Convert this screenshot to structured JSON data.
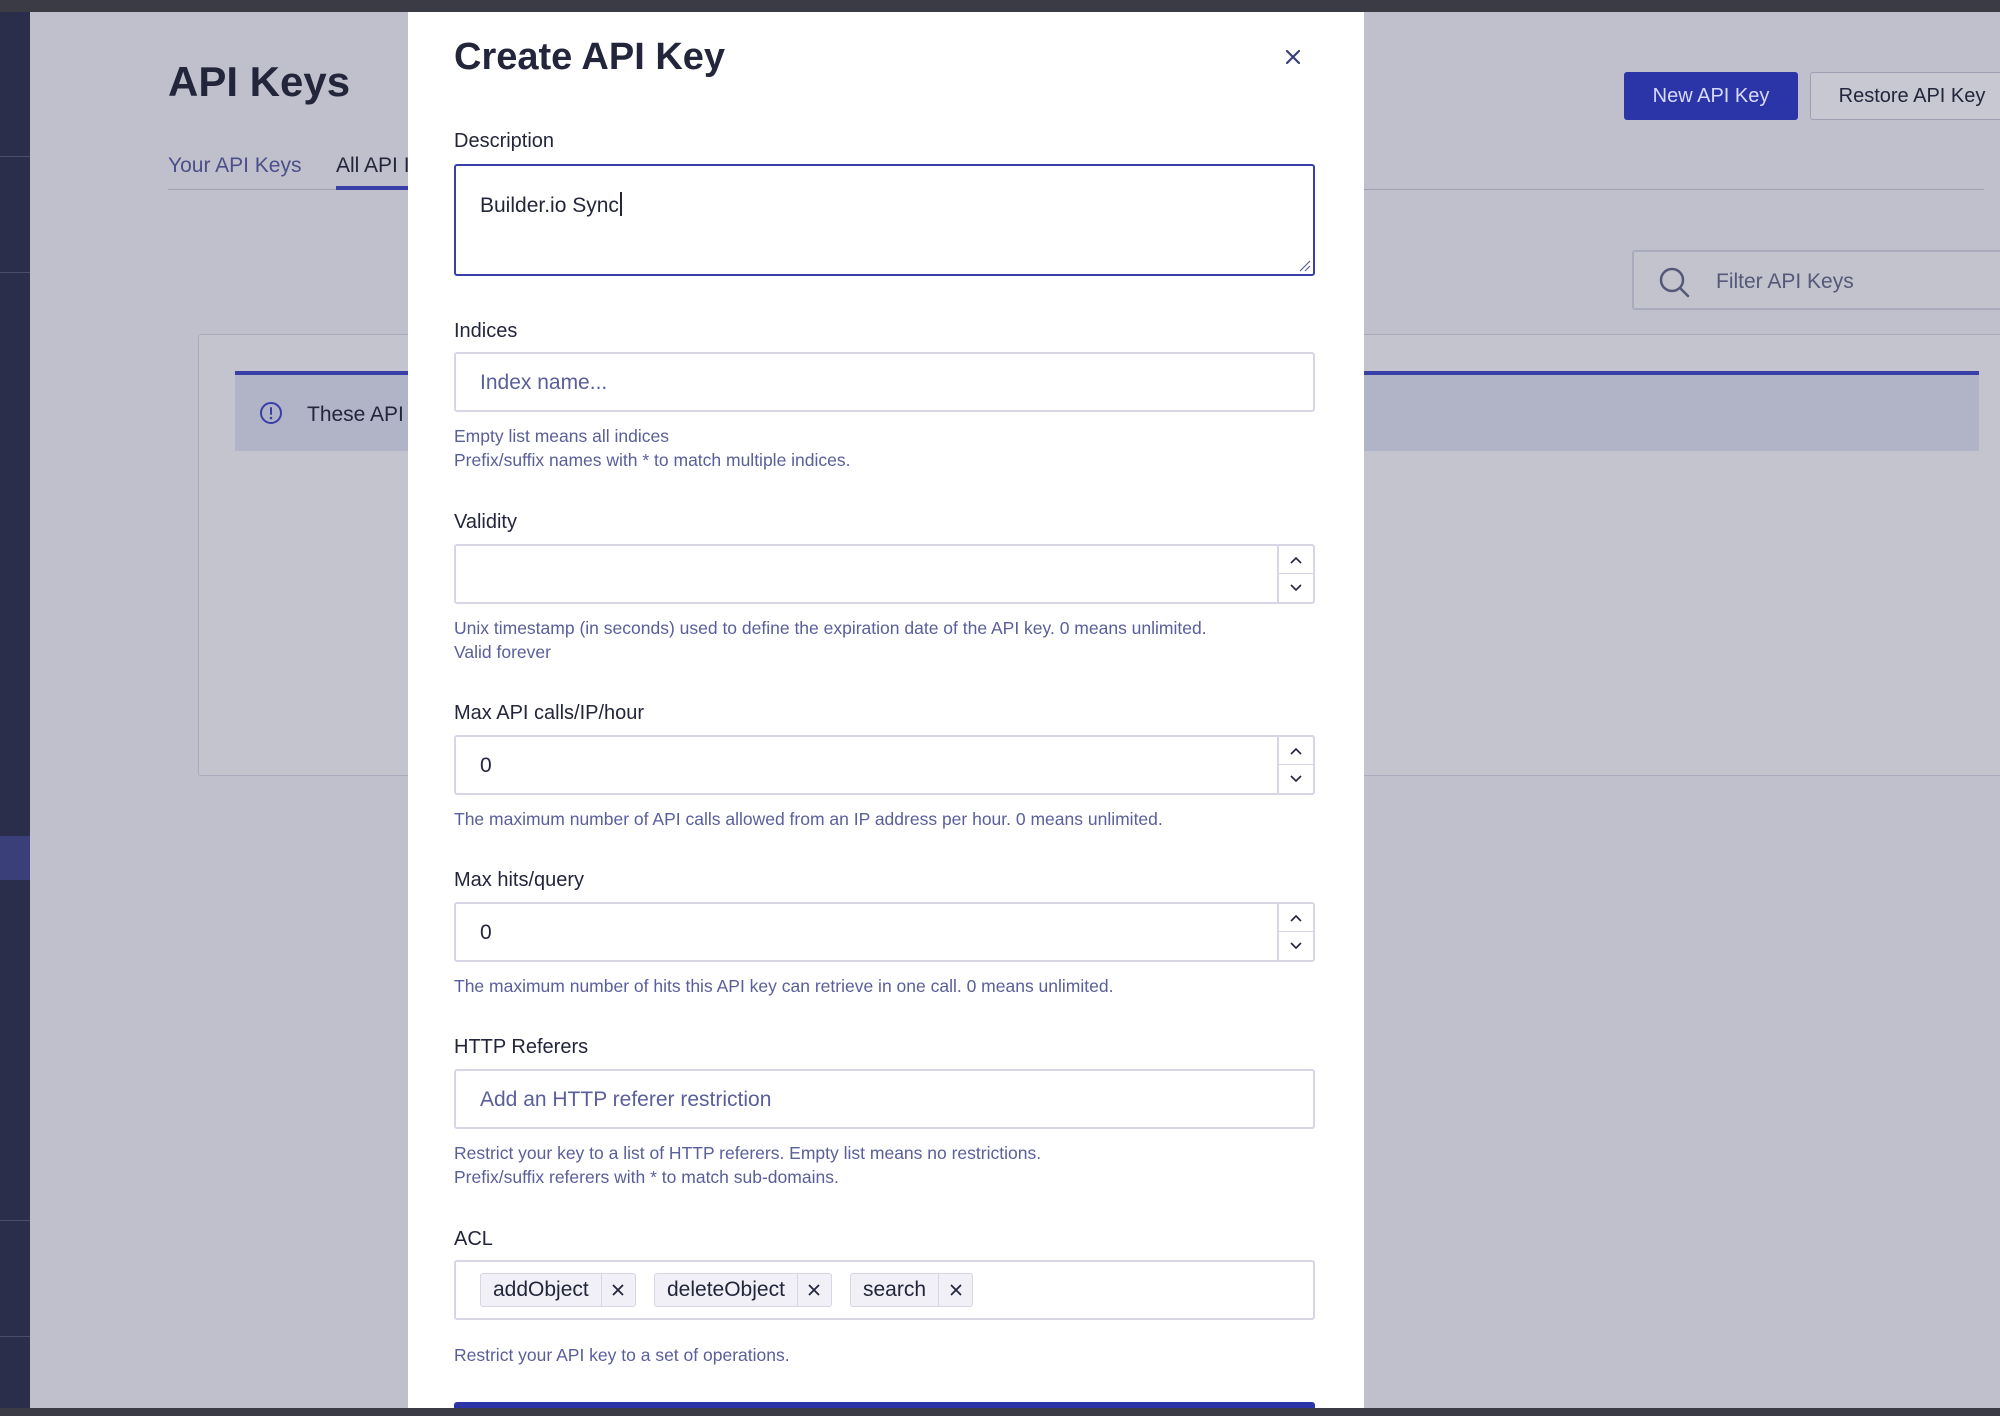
{
  "background": {
    "page_title": "API Keys",
    "tabs": [
      {
        "label": "Your API Keys"
      },
      {
        "label": "All API I"
      }
    ],
    "new_button": "New API Key",
    "restore_button": "Restore API Key",
    "filter_placeholder": "Filter API Keys",
    "banner_text": "These API Key"
  },
  "modal": {
    "title": "Create API Key",
    "description": {
      "label": "Description",
      "value": "Builder.io Sync"
    },
    "indices": {
      "label": "Indices",
      "placeholder": "Index name...",
      "help_1": "Empty list means all indices",
      "help_2": "Prefix/suffix names with * to match multiple indices."
    },
    "validity": {
      "label": "Validity",
      "value": "",
      "help_1": "Unix timestamp (in seconds) used to define the expiration date of the API key. 0 means unlimited.",
      "help_2": "Valid forever"
    },
    "max_calls": {
      "label": "Max API calls/IP/hour",
      "value": "0",
      "help": "The maximum number of API calls allowed from an IP address per hour. 0 means unlimited."
    },
    "max_hits": {
      "label": "Max hits/query",
      "value": "0",
      "help": "The maximum number of hits this API key can retrieve in one call. 0 means unlimited."
    },
    "referers": {
      "label": "HTTP Referers",
      "placeholder": "Add an HTTP referer restriction",
      "help_1": "Restrict your key to a list of HTTP referers. Empty list means no restrictions.",
      "help_2": "Prefix/suffix referers with * to match sub-domains."
    },
    "acl": {
      "label": "ACL",
      "tags": [
        "addObject",
        "deleteObject",
        "search"
      ],
      "help": "Restrict your API key to a set of operations."
    }
  },
  "colors": {
    "accent": "#2c35a8",
    "focus_border": "#3a3fa8",
    "help_text": "#5a5e9a",
    "text": "#23263b"
  }
}
